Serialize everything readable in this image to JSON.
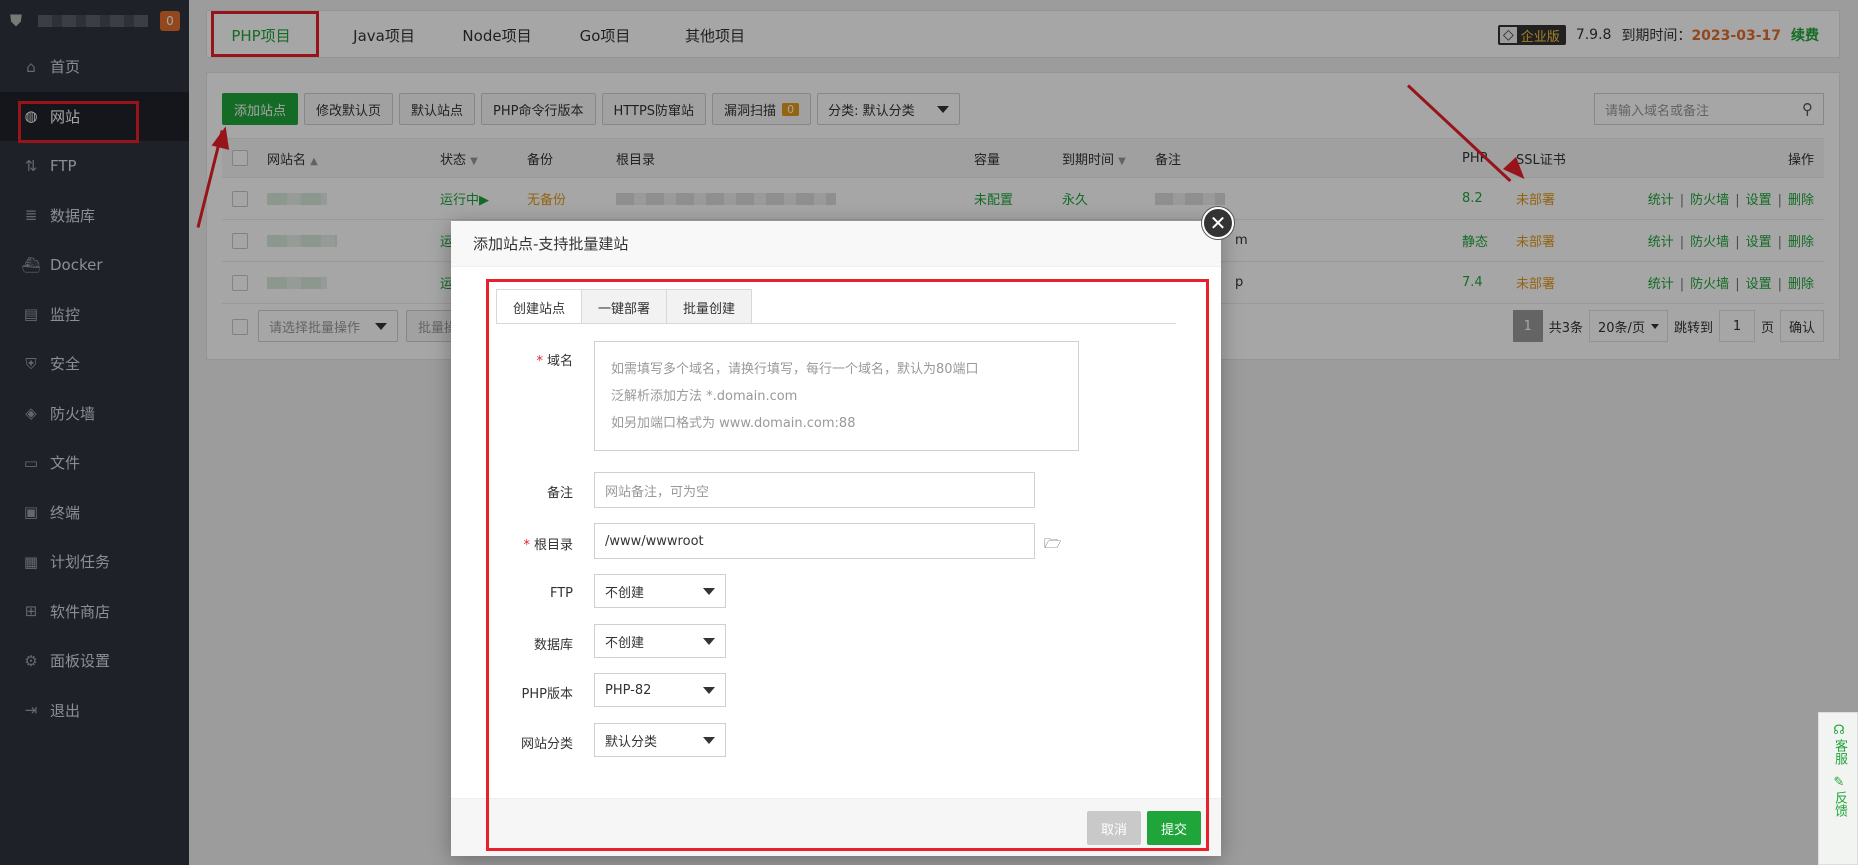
{
  "sidebar": {
    "badge": "0",
    "items": [
      {
        "label": "首页",
        "icon": "home-icon",
        "glyph": "⌂"
      },
      {
        "label": "网站",
        "icon": "globe-icon",
        "glyph": "◍"
      },
      {
        "label": "FTP",
        "icon": "ftp-icon",
        "glyph": "⇅"
      },
      {
        "label": "数据库",
        "icon": "database-icon",
        "glyph": "≣"
      },
      {
        "label": "Docker",
        "icon": "docker-icon",
        "glyph": "⛴"
      },
      {
        "label": "监控",
        "icon": "monitor-icon",
        "glyph": "▤"
      },
      {
        "label": "安全",
        "icon": "shield-icon",
        "glyph": "⛨"
      },
      {
        "label": "防火墙",
        "icon": "firewall-icon",
        "glyph": "◈"
      },
      {
        "label": "文件",
        "icon": "folder-icon",
        "glyph": "▭"
      },
      {
        "label": "终端",
        "icon": "terminal-icon",
        "glyph": "▣"
      },
      {
        "label": "计划任务",
        "icon": "calendar-icon",
        "glyph": "▦"
      },
      {
        "label": "软件商店",
        "icon": "apps-icon",
        "glyph": "⊞"
      },
      {
        "label": "面板设置",
        "icon": "gear-icon",
        "glyph": "⚙"
      },
      {
        "label": "退出",
        "icon": "logout-icon",
        "glyph": "⇥"
      }
    ]
  },
  "topbar": {
    "tabs": [
      "PHP项目",
      "Java项目",
      "Node项目",
      "Go项目",
      "其他项目"
    ],
    "edition": "企业版",
    "version": "7.9.8",
    "expire_label": "到期时间：",
    "expire_date": "2023-03-17",
    "renew": "续费"
  },
  "toolbar": {
    "add_site": "添加站点",
    "modify_default": "修改默认页",
    "default_site": "默认站点",
    "php_cli": "PHP命令行版本",
    "https_guard": "HTTPS防窜站",
    "vuln_scan": "漏洞扫描",
    "vuln_count": "0",
    "category": "分类: 默认分类",
    "search_placeholder": "请输入域名或备注"
  },
  "table": {
    "headers": {
      "name": "网站名",
      "status": "状态",
      "backup": "备份",
      "root": "根目录",
      "quota": "容量",
      "expire": "到期时间",
      "remark": "备注",
      "php": "PHP",
      "ssl": "SSL证书",
      "ops": "操作"
    },
    "rows": [
      {
        "status": "运行中▶",
        "backup": "无备份",
        "quota": "未配置",
        "expire": "永久",
        "remark_tail": "",
        "php": "8.2",
        "ssl": "未部署"
      },
      {
        "status": "运",
        "backup": "",
        "quota": "",
        "expire": "",
        "remark_tail": "m",
        "php": "静态",
        "ssl": "未部署"
      },
      {
        "status": "运",
        "backup": "",
        "quota": "",
        "expire": "",
        "remark_tail": "p",
        "php": "7.4",
        "ssl": "未部署"
      }
    ],
    "ops": [
      "统计",
      "防火墙",
      "设置",
      "删除"
    ]
  },
  "footer": {
    "batch_placeholder": "请选择批量操作",
    "batch_btn": "批量操",
    "page": "1",
    "total": "共3条",
    "per_page": "20条/页",
    "jump_to": "跳转到",
    "jump_value": "1",
    "page_unit": "页",
    "confirm": "确认"
  },
  "modal": {
    "title": "添加站点-支持批量建站",
    "tabs": [
      "创建站点",
      "一键部署",
      "批量创建"
    ],
    "domain_label": "域名",
    "domain_hint_1": "如需填写多个域名，请换行填写，每行一个域名，默认为80端口",
    "domain_hint_2": "泛解析添加方法 *.domain.com",
    "domain_hint_3": "如另加端口格式为 www.domain.com:88",
    "remark_label": "备注",
    "remark_placeholder": "网站备注，可为空",
    "root_label": "根目录",
    "root_value": "/www/wwwroot",
    "ftp_label": "FTP",
    "ftp_value": "不创建",
    "db_label": "数据库",
    "db_value": "不创建",
    "php_label": "PHP版本",
    "php_value": "PHP-82",
    "category_label": "网站分类",
    "category_value": "默认分类",
    "cancel": "取消",
    "submit": "提交"
  },
  "float": {
    "service": "客服",
    "feedback": "反馈"
  },
  "colors": {
    "brand_green": "#20a53a",
    "warning_orange": "#e29a1b",
    "annotation_red": "#e8202a",
    "sidebar_bg": "#2f333e"
  }
}
